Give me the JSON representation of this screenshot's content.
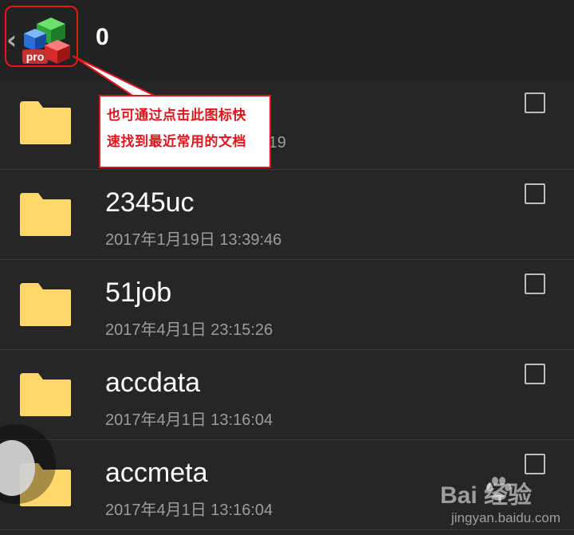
{
  "toolbar": {
    "back_icon": "chevron-left-icon",
    "logo_icon": "officesuite-pro-logo",
    "logo_badge": "pro",
    "title": "0"
  },
  "callout": {
    "line1": "也可通过点击此图标快",
    "line2": "速找到最近常用的文档",
    "color": "#e3141b"
  },
  "files": [
    {
      "name": "",
      "date": "3:19"
    },
    {
      "name": "2345uc",
      "date": "2017年1月19日 13:39:46"
    },
    {
      "name": "51job",
      "date": "2017年4月1日 23:15:26"
    },
    {
      "name": "accdata",
      "date": "2017年4月1日 13:16:04"
    },
    {
      "name": "accmeta",
      "date": "2017年4月1日 13:16:04"
    }
  ],
  "watermark": {
    "word": "Bai  经验",
    "tagline": "jingyan.baidu.com"
  },
  "colors": {
    "background": "#262626",
    "folder": "#ffd76a",
    "highlight": "#e8161b"
  }
}
